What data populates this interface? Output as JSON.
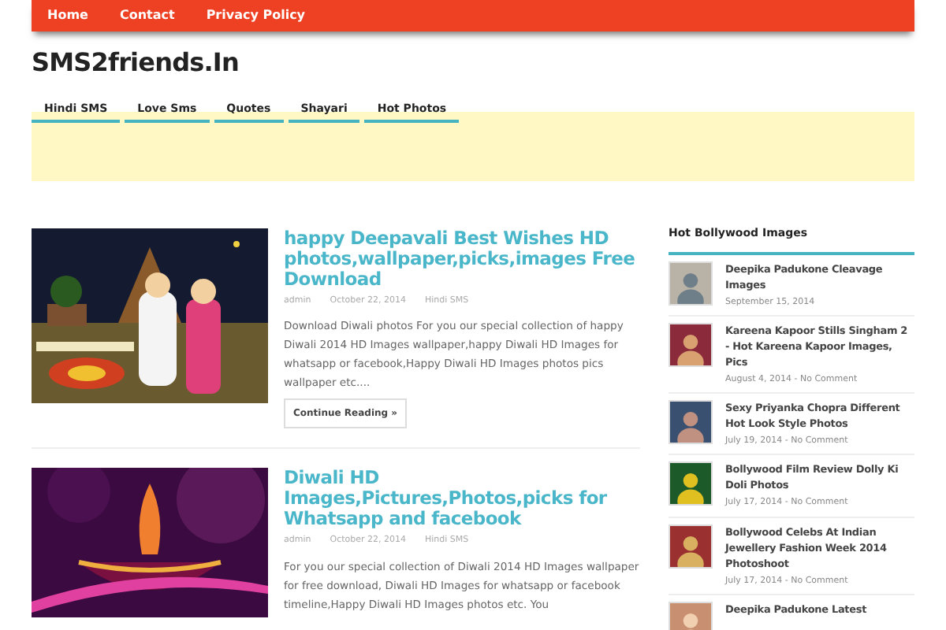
{
  "top_nav": [
    {
      "label": "Home"
    },
    {
      "label": "Contact"
    },
    {
      "label": "Privacy Policy"
    }
  ],
  "site_title": "SMS2friends.In",
  "menu": [
    {
      "label": "Hindi SMS"
    },
    {
      "label": "Love Sms"
    },
    {
      "label": "Quotes"
    },
    {
      "label": "Shayari"
    },
    {
      "label": "Hot Photos"
    }
  ],
  "posts": [
    {
      "kind": "night",
      "title": "happy Deepavali Best Wishes HD photos,wallpaper,picks,images Free Download",
      "author": "admin",
      "date": "October 22, 2014",
      "category": "Hindi SMS",
      "excerpt": "Download Diwali photos For you our special collection of happy Diwali 2014 HD Images wallpaper,happy Diwali HD Images for whatsapp or facebook,Happy Diwali HD Images photos pics wallpaper etc....",
      "button": "Continue Reading »"
    },
    {
      "kind": "purple",
      "title": "Diwali HD Images,Pictures,Photos,picks for Whatsapp and facebook",
      "author": "admin",
      "date": "October 22, 2014",
      "category": "Hindi SMS",
      "excerpt": "For you our special collection of Diwali 2014 HD Images wallpaper for free download, Diwali HD Images for whatsapp or facebook timeline,Happy Diwali HD Images photos etc. You"
    }
  ],
  "sidebar": {
    "heading": "Hot Bollywood Images",
    "items": [
      {
        "title": "Deepika Padukone Cleavage Images",
        "meta": "September 15, 2014"
      },
      {
        "title": "Kareena Kapoor Stills Singham 2 - Hot Kareena Kapoor Images, Pics",
        "meta": "August 4, 2014 - No Comment"
      },
      {
        "title": "Sexy Priyanka Chopra Different Hot Look Style Photos",
        "meta": "July 19, 2014 - No Comment"
      },
      {
        "title": "Bollywood Film Review Dolly Ki Doli Photos",
        "meta": "July 17, 2014 - No Comment"
      },
      {
        "title": "Bollywood Celebs At Indian Jewellery Fashion Week 2014 Photoshoot",
        "meta": "July 17, 2014 - No Comment"
      },
      {
        "title": "Deepika Padukone Latest"
      }
    ]
  }
}
